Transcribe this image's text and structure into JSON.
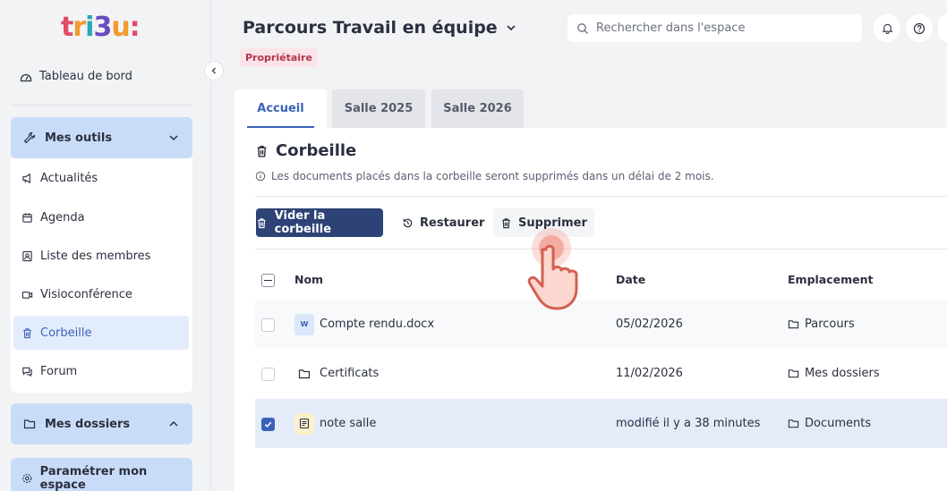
{
  "logo": {
    "text": "tri3u:",
    "colors": [
      "#e24a6a",
      "#f29a2e",
      "#27a8b8",
      "#6a4bbf"
    ]
  },
  "sidebar": {
    "dashboard": "Tableau de bord",
    "tools": {
      "label": "Mes outils",
      "items": [
        {
          "label": "Actualités",
          "icon": "megaphone-icon"
        },
        {
          "label": "Agenda",
          "icon": "calendar-icon"
        },
        {
          "label": "Liste des membres",
          "icon": "members-icon"
        },
        {
          "label": "Visioconférence",
          "icon": "video-icon"
        },
        {
          "label": "Corbeille",
          "icon": "trash-icon",
          "active": true
        },
        {
          "label": "Forum",
          "icon": "forum-icon"
        }
      ]
    },
    "folders": {
      "label": "Mes dossiers"
    },
    "settings": {
      "label": "Paramétrer mon espace"
    }
  },
  "header": {
    "title": "Parcours Travail en équipe",
    "role_badge": "Propriétaire",
    "search_placeholder": "Rechercher dans l'espace"
  },
  "tabs": [
    {
      "label": "Accueil",
      "active": true
    },
    {
      "label": "Salle 2025",
      "active": false
    },
    {
      "label": "Salle 2026",
      "active": false
    }
  ],
  "trash": {
    "title": "Corbeille",
    "info": "Les documents placés dans la corbeille seront supprimés dans un délai de 2 mois.",
    "actions": {
      "empty": "Vider la corbeille",
      "restore": "Restaurer",
      "delete": "Supprimer"
    },
    "columns": {
      "name": "Nom",
      "date": "Date",
      "location": "Emplacement"
    },
    "rows": [
      {
        "name": "Compte rendu.docx",
        "type": "word",
        "type_label": "W",
        "date": "05/02/2026",
        "location": "Parcours",
        "checked": false
      },
      {
        "name": "Certificats",
        "type": "folder",
        "date": "11/02/2026",
        "location": "Mes dossiers",
        "checked": false
      },
      {
        "name": "note salle",
        "type": "note",
        "date": "modifié il y a 38 minutes",
        "location": "Documents",
        "checked": true
      }
    ]
  },
  "colors": {
    "accent": "#3a63b8",
    "primary_button": "#2d4275",
    "sidebar_header": "#c9dcf7",
    "badge_bg": "#fbe4e9",
    "badge_text": "#b3344c",
    "selected_row": "#e4ecfa"
  }
}
